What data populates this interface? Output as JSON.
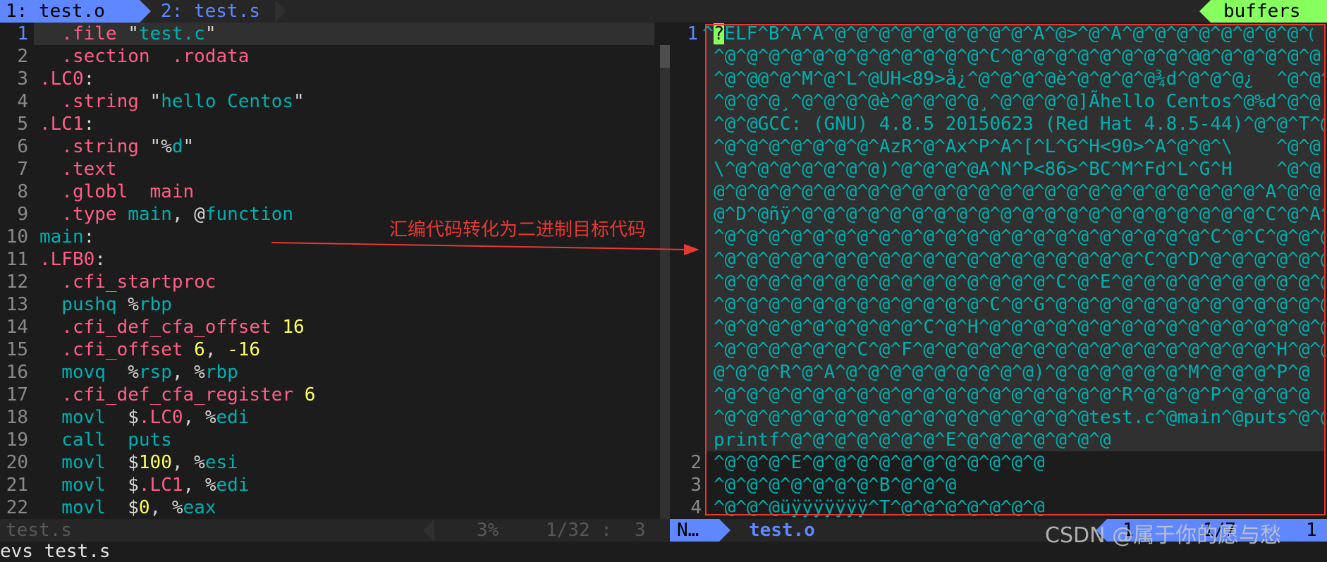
{
  "tabs": [
    {
      "label": "1: test.o"
    },
    {
      "label": "2: test.s"
    }
  ],
  "buffers_label": "buffers",
  "left_pane": {
    "filename": "test.s",
    "percent": "3%",
    "position": "1/32 :",
    "column": "3",
    "lines": [
      {
        "n": "1",
        "parts": [
          [
            "dir",
            "  .file "
          ],
          [
            "plain",
            "\""
          ],
          [
            "str",
            "test.c"
          ],
          [
            "plain",
            "\""
          ]
        ]
      },
      {
        "n": "2",
        "parts": [
          [
            "dir",
            "  .section  .rodata"
          ]
        ]
      },
      {
        "n": "3",
        "parts": [
          [
            "dir",
            ".LC0"
          ],
          [
            "plain",
            ":"
          ]
        ]
      },
      {
        "n": "4",
        "parts": [
          [
            "dir",
            "  .string "
          ],
          [
            "plain",
            "\""
          ],
          [
            "str",
            "hello Centos"
          ],
          [
            "plain",
            "\""
          ]
        ]
      },
      {
        "n": "5",
        "parts": [
          [
            "dir",
            ".LC1"
          ],
          [
            "plain",
            ":"
          ]
        ]
      },
      {
        "n": "6",
        "parts": [
          [
            "dir",
            "  .string "
          ],
          [
            "plain",
            "\"%"
          ],
          [
            "str",
            "d"
          ],
          [
            "plain",
            "\""
          ]
        ]
      },
      {
        "n": "7",
        "parts": [
          [
            "dir",
            "  .text"
          ]
        ]
      },
      {
        "n": "8",
        "parts": [
          [
            "dir",
            "  .globl  main"
          ]
        ]
      },
      {
        "n": "9",
        "parts": [
          [
            "dir",
            "  .type "
          ],
          [
            "str",
            "main"
          ],
          [
            "plain",
            ", @"
          ],
          [
            "str",
            "function"
          ]
        ]
      },
      {
        "n": "10",
        "parts": [
          [
            "label",
            "main"
          ],
          [
            "plain",
            ":"
          ]
        ]
      },
      {
        "n": "11",
        "parts": [
          [
            "dir",
            ".LFB0"
          ],
          [
            "plain",
            ":"
          ]
        ]
      },
      {
        "n": "12",
        "parts": [
          [
            "dir",
            "  .cfi_startproc"
          ]
        ]
      },
      {
        "n": "13",
        "parts": [
          [
            "ins",
            "  pushq "
          ],
          [
            "plain",
            "%"
          ],
          [
            "ins",
            "rbp"
          ]
        ]
      },
      {
        "n": "14",
        "parts": [
          [
            "dir",
            "  .cfi_def_cfa_offset "
          ],
          [
            "num",
            "16"
          ]
        ]
      },
      {
        "n": "15",
        "parts": [
          [
            "dir",
            "  .cfi_offset "
          ],
          [
            "num",
            "6"
          ],
          [
            "plain",
            ", "
          ],
          [
            "num",
            "-16"
          ]
        ]
      },
      {
        "n": "16",
        "parts": [
          [
            "ins",
            "  movq  "
          ],
          [
            "plain",
            "%"
          ],
          [
            "ins",
            "rsp"
          ],
          [
            "plain",
            ", %"
          ],
          [
            "ins",
            "rbp"
          ]
        ]
      },
      {
        "n": "17",
        "parts": [
          [
            "dir",
            "  .cfi_def_cfa_register "
          ],
          [
            "num",
            "6"
          ]
        ]
      },
      {
        "n": "18",
        "parts": [
          [
            "ins",
            "  movl  "
          ],
          [
            "plain",
            "$"
          ],
          [
            "dir",
            ".LC0"
          ],
          [
            "plain",
            ", %"
          ],
          [
            "ins",
            "edi"
          ]
        ]
      },
      {
        "n": "19",
        "parts": [
          [
            "ins",
            "  call  puts"
          ]
        ]
      },
      {
        "n": "20",
        "parts": [
          [
            "ins",
            "  movl  "
          ],
          [
            "plain",
            "$"
          ],
          [
            "num",
            "100"
          ],
          [
            "plain",
            ", %"
          ],
          [
            "ins",
            "esi"
          ]
        ]
      },
      {
        "n": "21",
        "parts": [
          [
            "ins",
            "  movl  "
          ],
          [
            "plain",
            "$"
          ],
          [
            "dir",
            ".LC1"
          ],
          [
            "plain",
            ", %"
          ],
          [
            "ins",
            "edi"
          ]
        ]
      },
      {
        "n": "22",
        "parts": [
          [
            "ins",
            "  movl  "
          ],
          [
            "plain",
            "$"
          ],
          [
            "num",
            "0"
          ],
          [
            "plain",
            ", %"
          ],
          [
            "ins",
            "eax"
          ]
        ]
      }
    ]
  },
  "right_pane": {
    "mode": "N…",
    "filename": "test.o",
    "position": "1",
    "position2": "1/7",
    "column": "1",
    "line_numbers": [
      "1",
      "2",
      "3",
      "4"
    ],
    "rows": [
      "^?ELF^B^A^A^@^@^@^@^@^@^@^@^@^A^@>^@^A^@^@^@^@^@^@^@^@^@",
      "^@^@^@^@^@^@^@^@^@^@^@^@^C^@^@^@^@^@^@^@^@^@@^@^@^@^@^@",
      "^@^@@^@^M^@^L^@UH<89>å¿^@^@^@^@è^@^@^@^@¾d^@^@^@¿  ^@^@^@",
      "^@^@^@¸^@^@^@^@è^@^@^@^@¸^@^@^@^@]Ãhello Centos^@%d^@^@",
      "^@^@GCC: (GNU) 4.8.5 20150623 (Red Hat 4.8.5-44)^@^@^T^@",
      "^@^@^@^@^@^@^@^AzR^@^Ax^P^A^[^L^G^H<90>^A^@^@^\\    ^@^@",
      "\\^@^@^@^@^@^@^@)^@^@^@^@A^N^P<86>^BC^M^Fd^L^G^H    ^@^@",
      "@^@^@^@^@^@^@^@^@^@^@^@^@^@^@^@^@^@^@^@^@^@^@^@^@^A^@^@",
      "@^D^@ñÿ^@^@^@^@^@^@^@^@^@^@^@^@^@^@^@^@^@^@^@^@^@^C^@^A^@",
      "^@^@^@^@^@^@^@^@^@^@^@^@^@^@^@^@^@^@^@^@^@^@^C^@^C^@^@^@",
      "^@^@^@^@^@^@^@^@^@^@^@^@^@^@^@^@^@^@^@^C^@^D^@^@^@^@^@^@",
      "^@^@^@^@^@^@^@^@^@^@^@^@^@^@^@^C^@^E^@^@^@^@^@^@^@^@^@^@",
      "^@^@^@^@^@^@^@^@^@^@^@^@^C^@^G^@^@^@^@^@^@^@^@^@^@^@^@^@",
      "^@^@^@^@^@^@^@^@^@^C^@^H^@^@^@^@^@^@^@^@^@^@^@^@^@^@^@^@",
      "^@^@^@^@^@^@^C^@^F^@^@^@^@^@^@^@^@^@^@^@^@^@^@^@^@^H^@^@",
      "@^@^@^R^@^A^@^@^@^@^@^@^@^@^@)^@^@^@^@^@^@^M^@^@^@^P^@",
      "^@^@^@^@^@^@^@^@^@^@^@^@^@^@^@^@^@^@^R^@^@^@^P^@^@^@^@",
      "^@^@^@^@^@^@^@^@^@^@^@^@^@^@^@^@^@test.c^@main^@puts^@^@",
      "printf^@^@^@^@^@^@^@^E^@^@^@^@^@^@^@",
      "^@^@^@^E^@^@^@^@^@^@^@^@^@^@^@",
      "^@^@^@^@^@^@^@^B^@^@^@",
      "^@^@^@üÿÿÿÿÿÿÿ^T^@^@^@^@^@^@^@"
    ]
  },
  "annotation": "汇编代码转化为二进制目标代码",
  "cmdline": "evs test.s",
  "watermark": "CSDN @属于你的愿与愁",
  "colors": {
    "accent": "#5f87ff",
    "buffers": "#87ff5f",
    "highlight_box": "#e53935"
  }
}
